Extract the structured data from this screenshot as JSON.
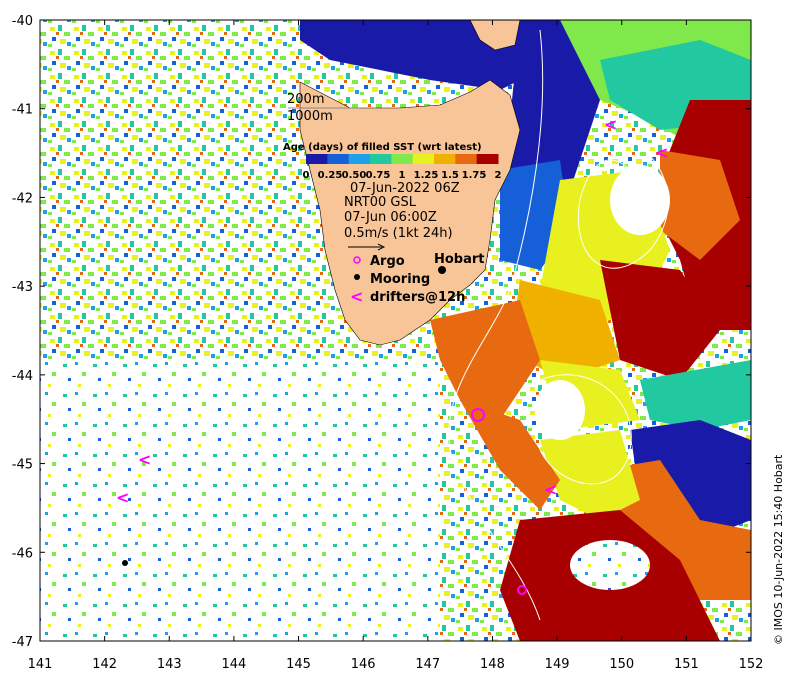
{
  "map": {
    "x_ticks": [
      "141",
      "142",
      "143",
      "144",
      "145",
      "146",
      "147",
      "148",
      "149",
      "150",
      "151",
      "152"
    ],
    "y_ticks": [
      "-40",
      "-41",
      "-42",
      "-43",
      "-44",
      "-45",
      "-46",
      "-47"
    ],
    "lon_range": [
      141,
      152
    ],
    "lat_range": [
      -47,
      -40
    ]
  },
  "legend": {
    "contour_200": "200m",
    "contour_1000": "1000m",
    "colorbar_title": "Age (days) of filled SST (wrt latest)",
    "colorbar_ticks": [
      "0",
      "0.25",
      "0.50",
      "0.75",
      "1",
      "1.25",
      "1.5",
      "1.75",
      "2"
    ],
    "colorbar_colors": [
      "#1a1aa8",
      "#1560d8",
      "#1fa0e8",
      "#21c8a0",
      "#7fe84a",
      "#e8f020",
      "#f0b000",
      "#e86a10",
      "#a80000"
    ],
    "date": "07-Jun-2022 06Z",
    "product": "NRT00 GSL",
    "time": "07-Jun 06:00Z",
    "scale": "0.5m/s (1kt 24h)",
    "argo": "Argo",
    "mooring": "Mooring",
    "drifters": "drifters@12h",
    "drifter_symbol": "<",
    "city": "Hobart"
  },
  "credit": "© IMOS 10-Jun-2022 15:40 Hobart",
  "colors": {
    "land": "#f8c598",
    "deep_blue": "#1a1aa8",
    "argo": "#ff00ff",
    "drifter": "#ff00ff"
  }
}
